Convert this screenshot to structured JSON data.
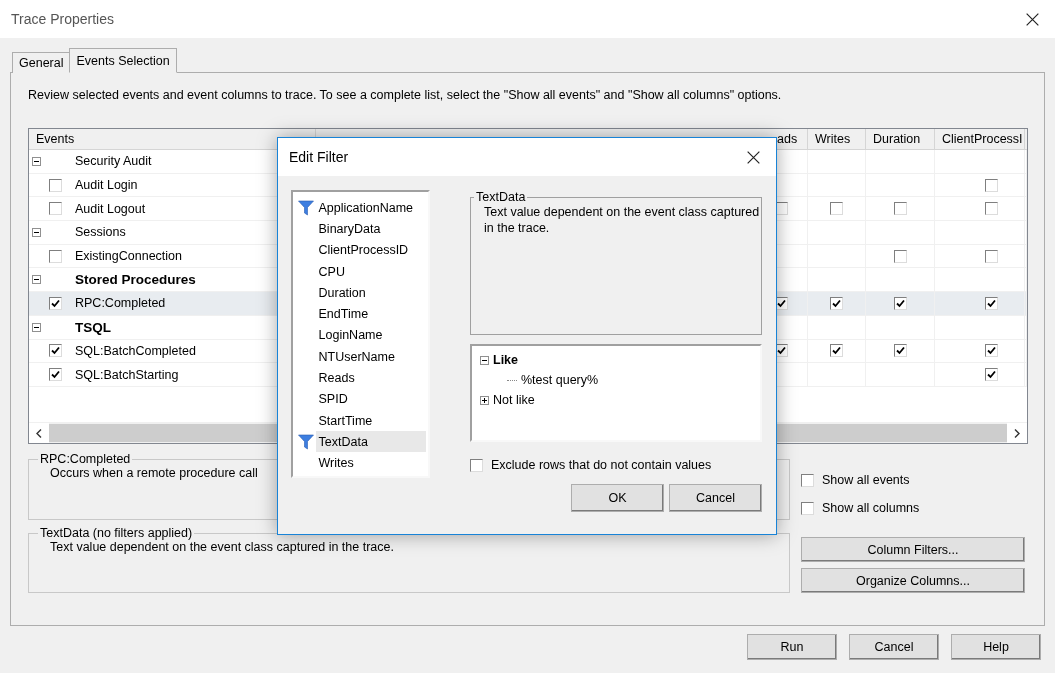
{
  "window": {
    "title": "Trace Properties"
  },
  "tabs": [
    {
      "label": "General",
      "selected": false
    },
    {
      "label": "Events Selection",
      "selected": true
    }
  ],
  "instructions": "Review selected events and event columns to trace. To see a complete list, select the \"Show all events\" and \"Show all columns\" options.",
  "events_grid": {
    "columns": [
      "Events",
      "ads",
      "Writes",
      "Duration",
      "ClientProcessI"
    ],
    "rows": [
      {
        "kind": "category",
        "label": "Security Audit",
        "expanded": true,
        "active": false,
        "selected": false,
        "cells": [
          null,
          null,
          null,
          null
        ]
      },
      {
        "kind": "event",
        "label": "Audit Login",
        "checked": false,
        "selected": false,
        "cells": [
          null,
          null,
          null,
          false
        ]
      },
      {
        "kind": "event",
        "label": "Audit Logout",
        "checked": false,
        "selected": false,
        "cells": [
          false,
          false,
          false,
          false
        ]
      },
      {
        "kind": "category",
        "label": "Sessions",
        "expanded": true,
        "active": false,
        "selected": false,
        "cells": [
          null,
          null,
          null,
          null
        ]
      },
      {
        "kind": "event",
        "label": "ExistingConnection",
        "checked": false,
        "selected": false,
        "cells": [
          null,
          null,
          false,
          false
        ]
      },
      {
        "kind": "category",
        "label": "Stored Procedures",
        "expanded": true,
        "active": true,
        "selected": false,
        "cells": [
          null,
          null,
          null,
          null
        ]
      },
      {
        "kind": "event",
        "label": "RPC:Completed",
        "checked": true,
        "selected": true,
        "cells": [
          true,
          true,
          true,
          true
        ]
      },
      {
        "kind": "category",
        "label": "TSQL",
        "expanded": true,
        "active": true,
        "selected": false,
        "cells": [
          null,
          null,
          null,
          null
        ]
      },
      {
        "kind": "event",
        "label": "SQL:BatchCompleted",
        "checked": true,
        "selected": false,
        "cells": [
          true,
          true,
          true,
          true
        ]
      },
      {
        "kind": "event",
        "label": "SQL:BatchStarting",
        "checked": true,
        "selected": false,
        "cells": [
          null,
          null,
          null,
          true
        ]
      }
    ]
  },
  "event_description": {
    "title": "RPC:Completed",
    "text": "Occurs when a remote procedure call"
  },
  "show_options": [
    {
      "label": "Show all events",
      "checked": false
    },
    {
      "label": "Show all columns",
      "checked": false
    }
  ],
  "column_description": {
    "title": "TextData (no filters applied)",
    "text": "Text value dependent on the event class captured in the trace."
  },
  "side_buttons": [
    "Column Filters...",
    "Organize Columns..."
  ],
  "footer_buttons": [
    "Run",
    "Cancel",
    "Help"
  ],
  "edit_filter": {
    "title": "Edit Filter",
    "columns": [
      {
        "label": "ApplicationName",
        "filtered": true,
        "selected": false
      },
      {
        "label": "BinaryData",
        "filtered": false,
        "selected": false
      },
      {
        "label": "ClientProcessID",
        "filtered": false,
        "selected": false
      },
      {
        "label": "CPU",
        "filtered": false,
        "selected": false
      },
      {
        "label": "Duration",
        "filtered": false,
        "selected": false
      },
      {
        "label": "EndTime",
        "filtered": false,
        "selected": false
      },
      {
        "label": "LoginName",
        "filtered": false,
        "selected": false
      },
      {
        "label": "NTUserName",
        "filtered": false,
        "selected": false
      },
      {
        "label": "Reads",
        "filtered": false,
        "selected": false
      },
      {
        "label": "SPID",
        "filtered": false,
        "selected": false
      },
      {
        "label": "StartTime",
        "filtered": false,
        "selected": false
      },
      {
        "label": "TextData",
        "filtered": true,
        "selected": true
      },
      {
        "label": "Writes",
        "filtered": false,
        "selected": false
      }
    ],
    "description": {
      "title": "TextData",
      "text": "Text value dependent on the event class captured in the trace."
    },
    "conditions": [
      {
        "label": "Like",
        "expanded": true,
        "active": true,
        "children": [
          {
            "label": "%test query%"
          }
        ]
      },
      {
        "label": "Not like",
        "expanded": false,
        "active": false
      }
    ],
    "exclude_empty": {
      "label": "Exclude rows that do not contain values",
      "checked": false
    },
    "buttons": [
      "OK",
      "Cancel"
    ]
  }
}
